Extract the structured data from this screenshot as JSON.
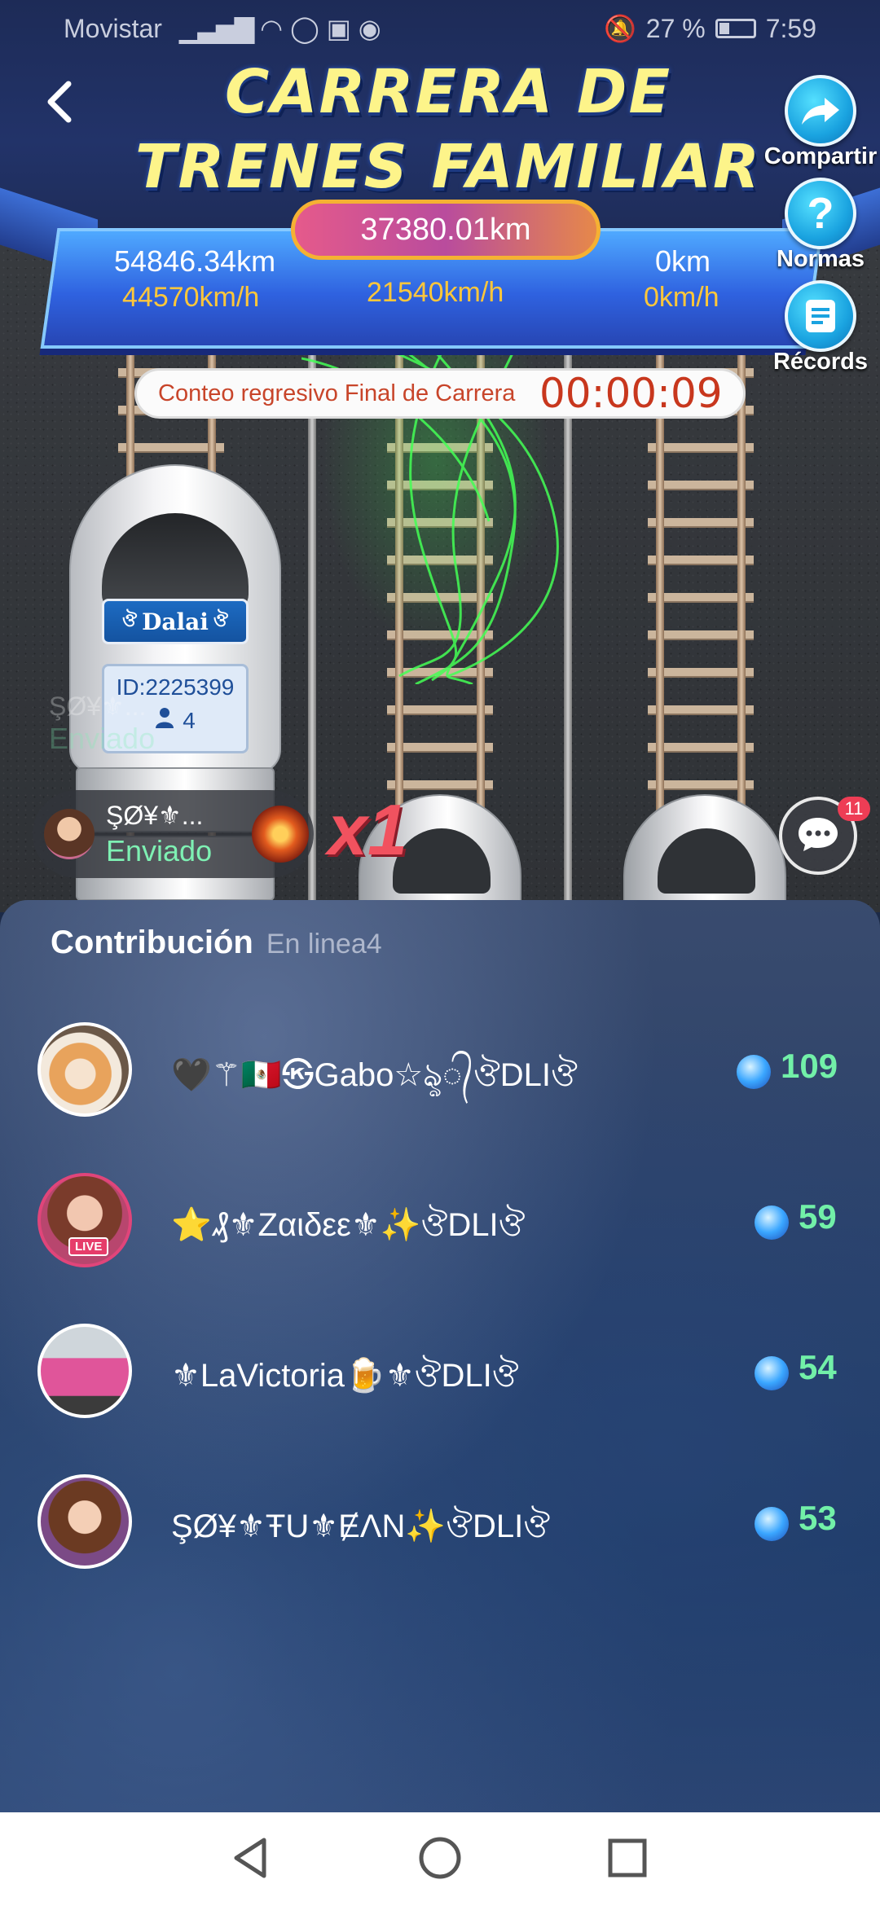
{
  "status_bar": {
    "carrier": "Movistar",
    "battery": "27 %",
    "time": "7:59"
  },
  "header": {
    "title_line1": "CARRERA DE",
    "title_line2": "TRENES FAMILIAR"
  },
  "side_buttons": {
    "share": "Compartir",
    "rules": "Normas",
    "records": "Récords"
  },
  "scoreboard": {
    "top_distance": "37380.01km",
    "left_distance": "54846.34km",
    "left_speed": "44570km/h",
    "mid_speed": "21540km/h",
    "right_distance": "0km",
    "right_speed": "0km/h"
  },
  "countdown": {
    "label": "Conteo regresivo Final de Carrera",
    "time": "00:00:09"
  },
  "train": {
    "name": "Dalai",
    "id_text": "ID:2225399",
    "member_count": "4"
  },
  "gift_notice": {
    "user": "ŞØ¥⚜...",
    "status": "Enviado",
    "multiplier": "x1"
  },
  "ghost_notice": {
    "user": "ŞØ¥⚜...",
    "status": "Enviado"
  },
  "chat": {
    "badge": "11"
  },
  "contribution": {
    "title": "Contribución",
    "online": "En linea4",
    "rows": [
      {
        "name": "🖤⚚🇲🇽㉿Gabo☆ৡ᭄ঔDLIঔ",
        "score": "109",
        "avatar": "kitten"
      },
      {
        "name": "⭐️₰⚜Zαιδεε⚜✨ঔDLIঔ",
        "score": "59",
        "avatar": "woman-glasses",
        "live": "LIVE"
      },
      {
        "name": "⚜LaVictoria🍺⚜ঔDLIঔ",
        "score": "54",
        "avatar": "pink-jeep"
      },
      {
        "name": "ŞØ¥⚜ŦU⚜ɆɅN✨ঔDLIঔ",
        "score": "53",
        "avatar": "cartoon-woman"
      }
    ]
  },
  "colors": {
    "score_green": "#72f0a8",
    "title_yellow": "#fdf48a",
    "countdown_red": "#c8371d"
  }
}
